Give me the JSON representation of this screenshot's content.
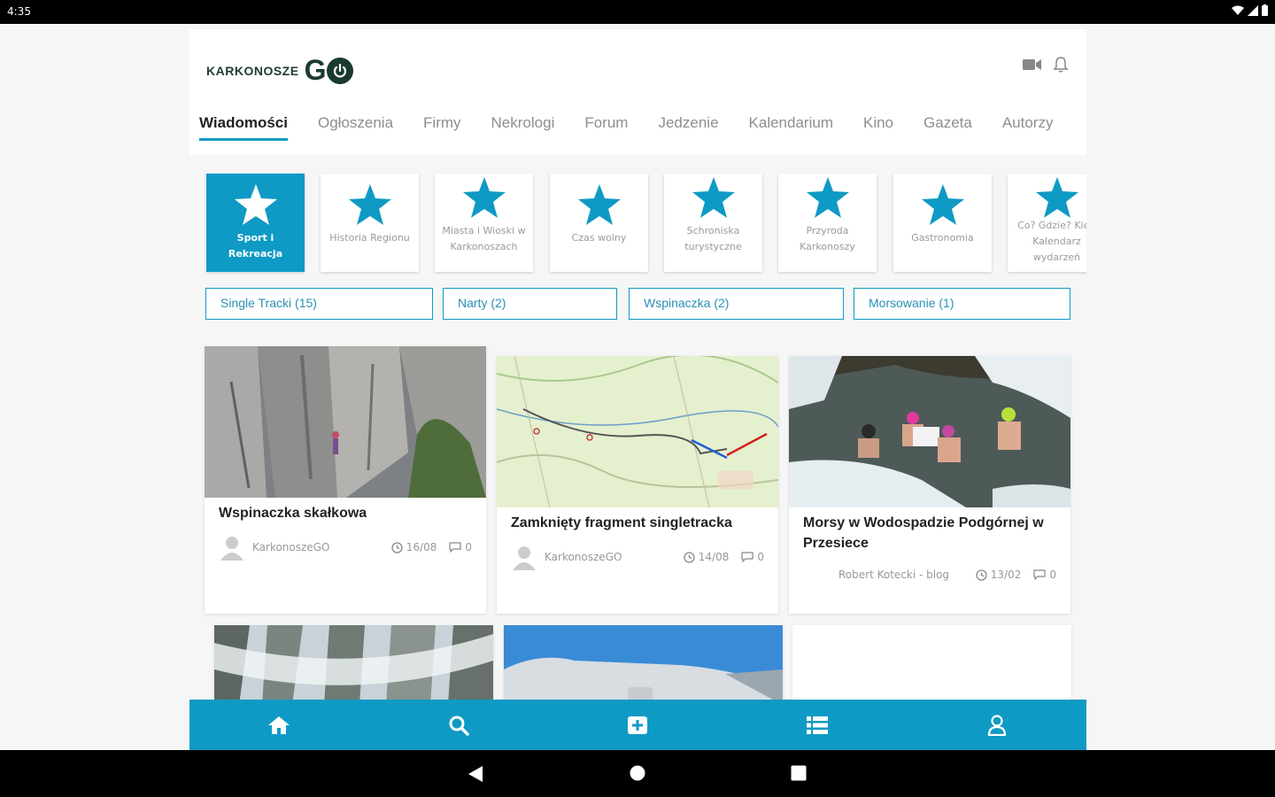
{
  "status_bar": {
    "time": "4:35"
  },
  "header": {
    "logo_text": "KARKONOSZE",
    "logo_go": "G"
  },
  "tabs": [
    {
      "label": "Wiadomości",
      "active": true
    },
    {
      "label": "Ogłoszenia"
    },
    {
      "label": "Firmy"
    },
    {
      "label": "Nekrologi"
    },
    {
      "label": "Forum"
    },
    {
      "label": "Jedzenie"
    },
    {
      "label": "Kalendarium"
    },
    {
      "label": "Kino"
    },
    {
      "label": "Gazeta"
    },
    {
      "label": "Autorzy"
    }
  ],
  "categories": [
    {
      "label": "Sport i Rekreacja",
      "icon": "star-icon",
      "active": true
    },
    {
      "label": "Historia Regionu",
      "icon": "star-icon"
    },
    {
      "label": "Miasta i Wioski w Karkonoszach",
      "icon": "star-icon"
    },
    {
      "label": "Czas wolny",
      "icon": "star-icon"
    },
    {
      "label": "Schroniska turystyczne",
      "icon": "star-icon"
    },
    {
      "label": "Przyroda Karkonoszy",
      "icon": "star-icon"
    },
    {
      "label": "Gastronomia",
      "icon": "star-icon"
    },
    {
      "label": "Co? Gdzie? Kie - Kalendarz wydarzeń",
      "icon": "star-icon"
    }
  ],
  "filters": [
    {
      "label": "Single Tracki (15)"
    },
    {
      "label": "Narty (2)"
    },
    {
      "label": "Wspinaczka (2)"
    },
    {
      "label": "Morsowanie (1)"
    }
  ],
  "articles": [
    {
      "title": "Wspinaczka skałkowa",
      "author": "KarkonoszeGO",
      "date": "16/08",
      "comments": "0",
      "image": "rock-climbing"
    },
    {
      "title": "Zamknięty fragment singletracka",
      "author": "KarkonoszeGO",
      "date": "14/08",
      "comments": "0",
      "image": "map"
    },
    {
      "title": "Morsy w Wodospadzie Podgórnej w Przesiece",
      "author": "Robert Kotecki - blog",
      "date": "13/02",
      "comments": "0",
      "image": "ice-swimming"
    }
  ],
  "bottom_nav": [
    {
      "icon": "home-icon"
    },
    {
      "icon": "search-icon"
    },
    {
      "icon": "add-post-icon"
    },
    {
      "icon": "list-icon"
    },
    {
      "icon": "user-icon"
    }
  ],
  "colors": {
    "accent": "#0e9ac4",
    "logo": "#1a3a2e"
  }
}
